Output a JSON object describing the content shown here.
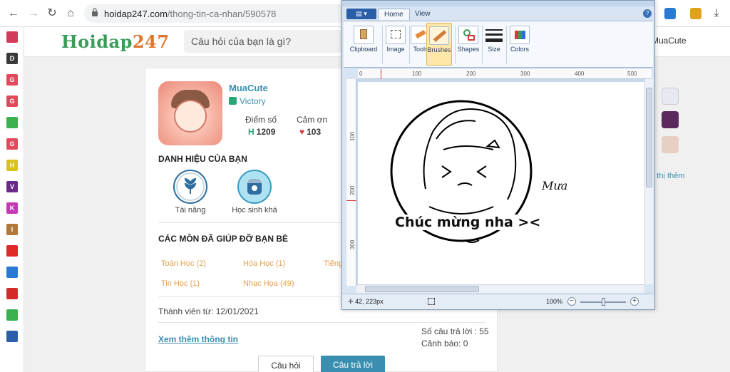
{
  "browser": {
    "url_host": "hoidap247.com",
    "url_path": "/thong-tin-ca-nhan/590578"
  },
  "sidebar_bookmarks": [
    {
      "letter": "",
      "color": "#d23b5b"
    },
    {
      "letter": "D",
      "color": "#3a3a3a"
    },
    {
      "letter": "G",
      "color": "#e04a5a"
    },
    {
      "letter": "G",
      "color": "#e04a5a"
    },
    {
      "letter": "",
      "color": "#3ab04e"
    },
    {
      "letter": "G",
      "color": "#e04a5a"
    },
    {
      "letter": "H",
      "color": "#d9c21a"
    },
    {
      "letter": "V",
      "color": "#6a2a8a"
    },
    {
      "letter": "K",
      "color": "#c33ab5"
    },
    {
      "letter": "I",
      "color": "#b0783a"
    },
    {
      "letter": "",
      "color": "#e02a2a"
    },
    {
      "letter": "",
      "color": "#2a7ad4"
    },
    {
      "letter": "",
      "color": "#d42a2a"
    },
    {
      "letter": "",
      "color": "#3ab04e"
    },
    {
      "letter": "",
      "color": "#2a5fa8"
    }
  ],
  "site": {
    "logo_main": "Hoidap",
    "logo_num": "247",
    "search_placeholder": "Câu hỏi của bạn là gì?",
    "header_user": "MuaCute"
  },
  "profile": {
    "username": "MuaCute",
    "rank": "Victory",
    "points_label": "Điểm số",
    "points_value": "1209",
    "thanks_label": "Cảm ơn",
    "thanks_value": "103",
    "titles_heading": "DANH HIỆU CỦA BẠN",
    "badges": [
      "Tài năng",
      "Học sinh khá"
    ],
    "subjects_heading": "CÁC MÔN ĐÃ GIÚP ĐỠ BẠN BÈ",
    "subjects": [
      "Toán Học (2)",
      "Hóa Học (1)",
      "Tiếng",
      "Tin Học (1)",
      "Nhạc Họa (49)"
    ],
    "joined": "Thành viên từ: 12/01/2021",
    "more_link": "Xem thêm thông tin",
    "answers": "Số câu trả lời : 55",
    "warnings": "Cảnh báo: 0",
    "tab_questions": "Câu hỏi",
    "tab_answers": "Câu trả lời"
  },
  "right_column": {
    "more_link": "ển thị thêm"
  },
  "paint": {
    "tabs": [
      "Home",
      "View"
    ],
    "groups": [
      "Clipboard",
      "Image",
      "Tools",
      "Brushes",
      "Shapes",
      "Size",
      "Colors"
    ],
    "ruler_top": [
      "0",
      "100",
      "200",
      "300",
      "400",
      "500"
    ],
    "ruler_left": [
      "100",
      "200",
      "300"
    ],
    "canvas_caption": "Chúc mừng nha ><",
    "canvas_signature": "Mưa",
    "coords": "42, 223px",
    "zoom": "100%"
  },
  "colors": {
    "accent": "#3a8fb0",
    "brand_green": "#3b9c5a",
    "subject_orange": "#e0a050",
    "answer_tab": "#3a8fb0"
  }
}
